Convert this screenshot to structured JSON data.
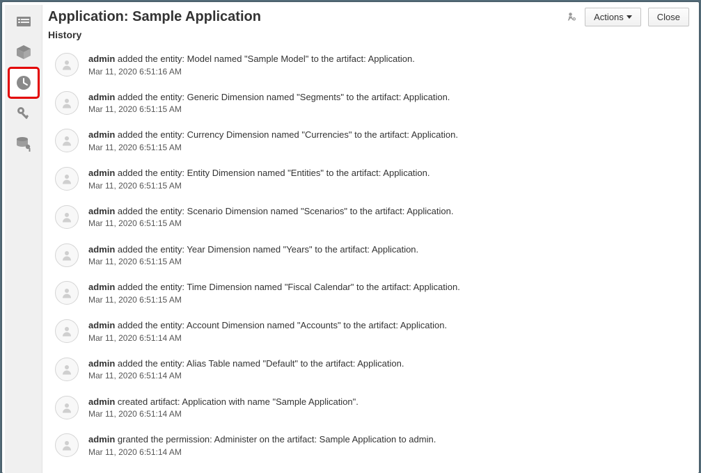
{
  "header": {
    "title": "Application: Sample Application",
    "actions_label": "Actions",
    "close_label": "Close",
    "section_label": "History"
  },
  "sidebar": {
    "items": [
      {
        "icon": "list-icon",
        "selected": false
      },
      {
        "icon": "cube-icon",
        "selected": false
      },
      {
        "icon": "clock-icon",
        "selected": true
      },
      {
        "icon": "key-icon",
        "selected": false
      },
      {
        "icon": "db-key-icon",
        "selected": false
      }
    ]
  },
  "history": [
    {
      "user": "admin",
      "message": " added the entity: Model named \"Sample Model\" to the artifact: Application.",
      "timestamp": "Mar 11, 2020 6:51:16 AM"
    },
    {
      "user": "admin",
      "message": " added the entity: Generic Dimension named \"Segments\" to the artifact: Application.",
      "timestamp": "Mar 11, 2020 6:51:15 AM"
    },
    {
      "user": "admin",
      "message": " added the entity: Currency Dimension named \"Currencies\" to the artifact: Application.",
      "timestamp": "Mar 11, 2020 6:51:15 AM"
    },
    {
      "user": "admin",
      "message": " added the entity: Entity Dimension named \"Entities\" to the artifact: Application.",
      "timestamp": "Mar 11, 2020 6:51:15 AM"
    },
    {
      "user": "admin",
      "message": " added the entity: Scenario Dimension named \"Scenarios\" to the artifact: Application.",
      "timestamp": "Mar 11, 2020 6:51:15 AM"
    },
    {
      "user": "admin",
      "message": " added the entity: Year Dimension named \"Years\" to the artifact: Application.",
      "timestamp": "Mar 11, 2020 6:51:15 AM"
    },
    {
      "user": "admin",
      "message": " added the entity: Time Dimension named \"Fiscal Calendar\" to the artifact: Application.",
      "timestamp": "Mar 11, 2020 6:51:15 AM"
    },
    {
      "user": "admin",
      "message": " added the entity: Account Dimension named \"Accounts\" to the artifact: Application.",
      "timestamp": "Mar 11, 2020 6:51:14 AM"
    },
    {
      "user": "admin",
      "message": " added the entity: Alias Table named \"Default\" to the artifact: Application.",
      "timestamp": "Mar 11, 2020 6:51:14 AM"
    },
    {
      "user": "admin",
      "message": " created artifact: Application with name \"Sample Application\".",
      "timestamp": "Mar 11, 2020 6:51:14 AM"
    },
    {
      "user": "admin",
      "message": " granted the permission: Administer on the artifact: Sample Application to admin.",
      "timestamp": "Mar 11, 2020 6:51:14 AM"
    }
  ]
}
